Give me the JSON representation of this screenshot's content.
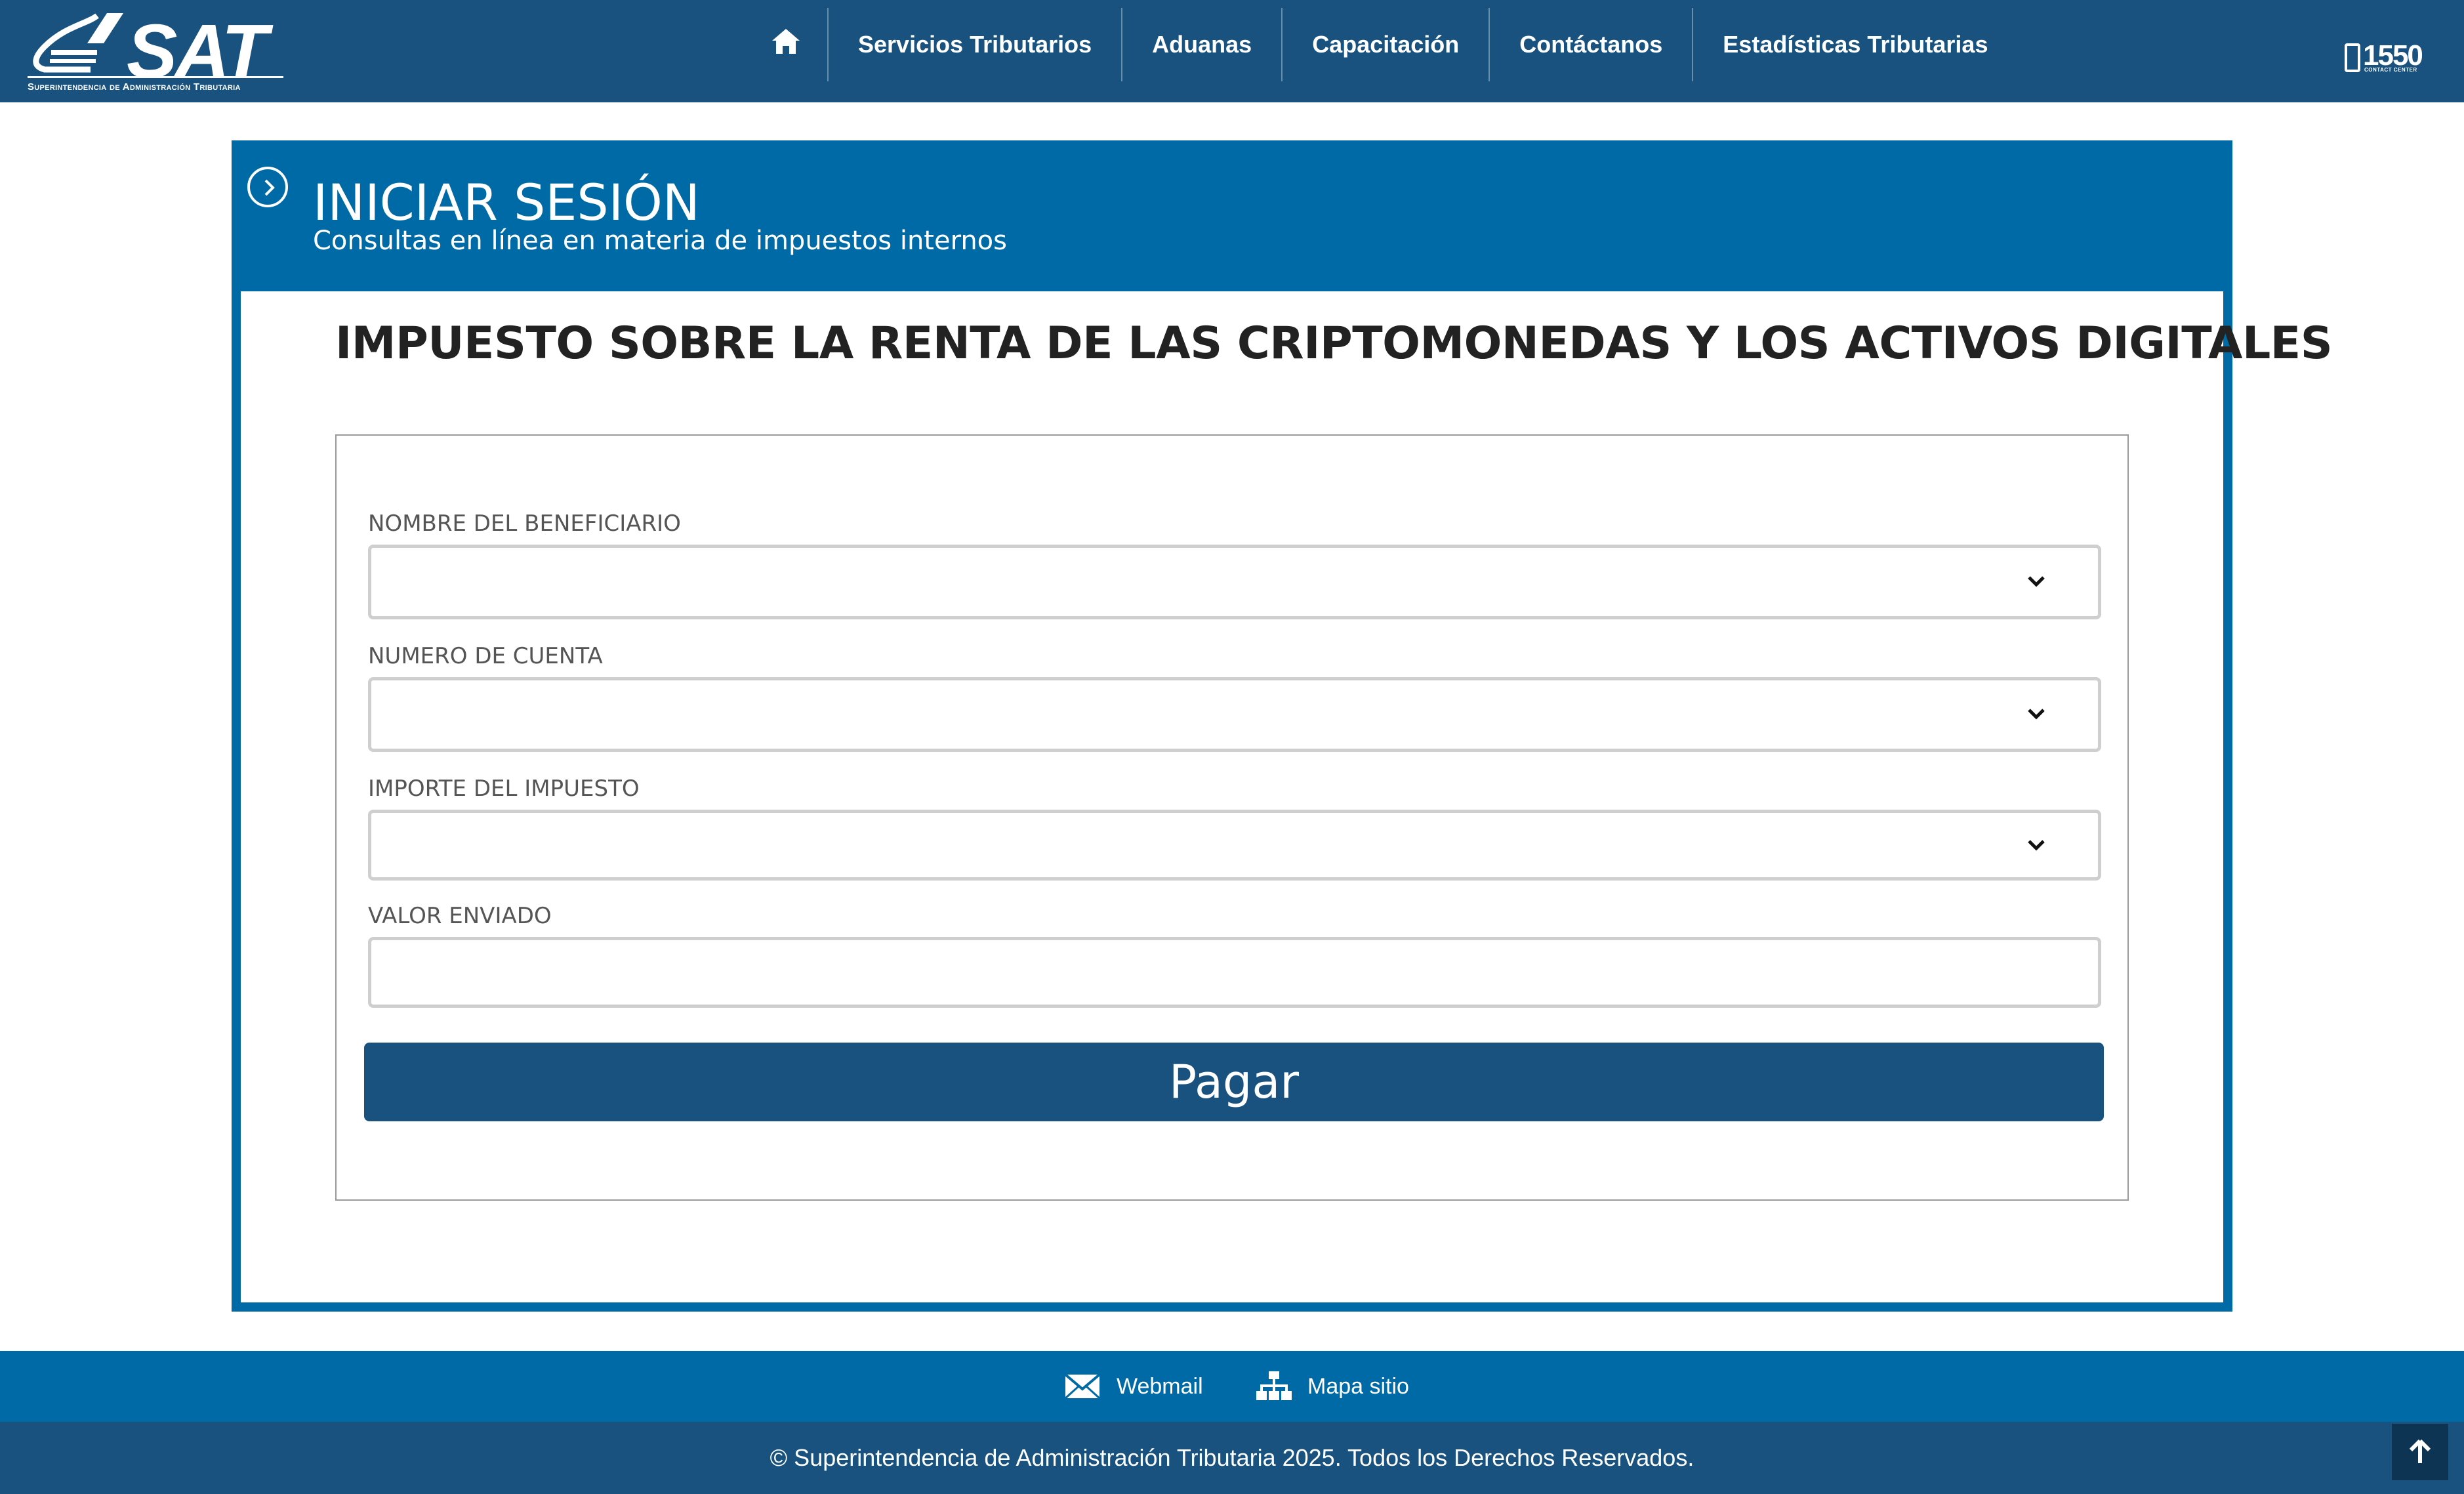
{
  "header": {
    "logo_text": "SAT",
    "logo_subtitle": "Superintendencia de Administración Tributaria",
    "nav": [
      {
        "label": "Servicios Tributarios"
      },
      {
        "label": "Aduanas"
      },
      {
        "label": "Capacitación"
      },
      {
        "label": "Contáctanos"
      },
      {
        "label": "Estadísticas Tributarias"
      }
    ],
    "contact_number": "1550",
    "contact_sub": "CONTACT CENTER"
  },
  "panel": {
    "title": "INICIAR SESIÓN",
    "subtitle": "Consultas en línea en materia de impuestos internos"
  },
  "form": {
    "heading": "IMPUESTO SOBRE LA RENTA DE LAS CRIPTOMONEDAS Y LOS ACTIVOS DIGITALES",
    "fields": {
      "beneficiary": {
        "label": "NOMBRE DEL BENEFICIARIO",
        "value": ""
      },
      "account": {
        "label": "NUMERO DE CUENTA",
        "value": ""
      },
      "amount": {
        "label": "IMPORTE DEL IMPUESTO",
        "value": ""
      },
      "sent_value": {
        "label": "VALOR ENVIADO",
        "value": "",
        "placeholder": ""
      }
    },
    "submit_label": "Pagar"
  },
  "footer": {
    "webmail_label": "Webmail",
    "sitemap_label": "Mapa sitio",
    "copyright": "© Superintendencia de Administración Tributaria 2025. Todos los Derechos Reservados."
  },
  "colors": {
    "nav_bg": "#19527f",
    "panel_blue": "#006aa6",
    "button_bg": "#19527f",
    "totop_bg": "#0d3553"
  }
}
